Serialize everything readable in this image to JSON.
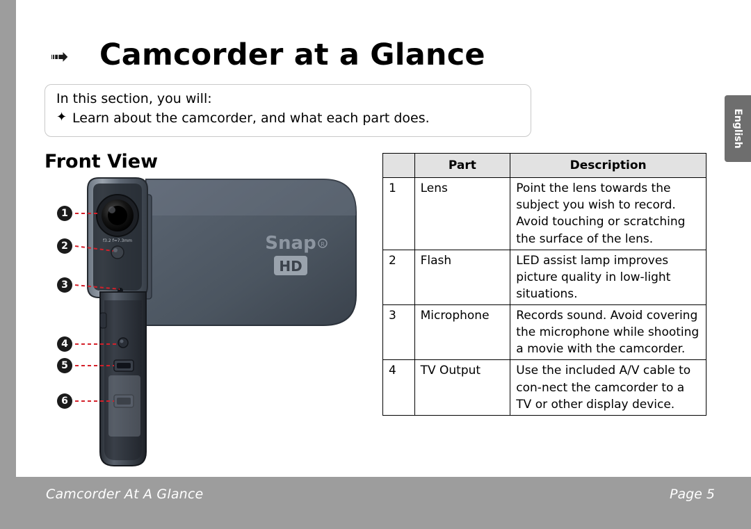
{
  "header": {
    "arrow_icon": "double-chevron-right-icon",
    "title": "Camcorder at a Glance"
  },
  "intro": {
    "line1": "In this section, you will:",
    "bullet_glyph": "✦",
    "line2": "Learn about the camcorder, and what each part does."
  },
  "section": {
    "heading": "Front View"
  },
  "side_tab": {
    "label": "English"
  },
  "table": {
    "headers": [
      "",
      "Part",
      "Description"
    ],
    "rows": [
      {
        "num": "1",
        "part": "Lens",
        "desc": "Point the lens towards the subject you wish to record. Avoid touching or scratching the surface of the lens."
      },
      {
        "num": "2",
        "part": "Flash",
        "desc": "LED assist lamp improves picture quality in low-light situations."
      },
      {
        "num": "3",
        "part": "Microphone",
        "desc": "Records sound. Avoid covering the microphone while shooting a movie with the camcorder."
      },
      {
        "num": "4",
        "part": "TV Output",
        "desc": "Use the included A/V cable to con-nect the camcorder to a TV or other display device."
      }
    ]
  },
  "illustration": {
    "brand_text": "Snap",
    "brand_mark": "®",
    "badge_text": "HD",
    "lens_text": "f3.2 f=7.3mm",
    "callouts": [
      "1",
      "2",
      "3",
      "4",
      "5",
      "6"
    ]
  },
  "footer": {
    "left": "Camcorder At A Glance",
    "right": "Page 5"
  }
}
